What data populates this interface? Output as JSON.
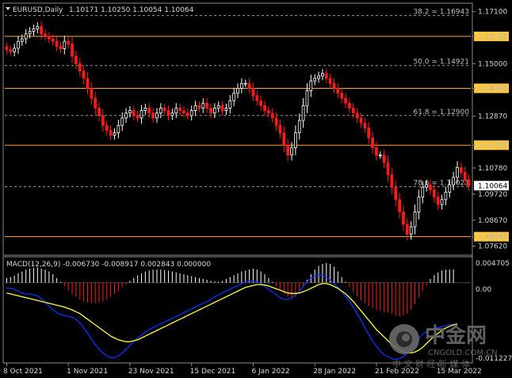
{
  "header": {
    "symbol": "EURUSD,Daily",
    "ohlc": "1.10171 1.10250 1.10054 1.10064"
  },
  "macd": {
    "label": "MACD(12,26,9) -0.006730 -0.008917 0.002843 0.000000",
    "ticks": [
      "0.004705",
      "0.00",
      "-0.011227"
    ]
  },
  "watermark": {
    "brand": "中金网",
    "domain": "CNGOLD.COM.CN",
    "tagline": "中 文 财 经 新 媒 体"
  },
  "colors": {
    "background": "#000000",
    "bull": "#ffffff",
    "bear": "#ff1a1a",
    "level_line": "#ffa733",
    "level_box": "#ffc83c",
    "grid": "#3a3a3a",
    "macd_line": "#0033ff",
    "signal_line": "#ffff33"
  },
  "chart_data": {
    "type": "candlestick",
    "symbol": "EURUSD",
    "timeframe": "Daily",
    "y_ticks": [
      "1.17100",
      "1.16100",
      "1.15000",
      "1.14000",
      "1.12870",
      "1.11700",
      "1.10780",
      "1.09720",
      "1.08670",
      "1.08000",
      "1.07620"
    ],
    "ylim": [
      1.0738,
      1.1738
    ],
    "x_ticks": [
      "8 Oct 2021",
      "1 Nov 2021",
      "23 Nov 2021",
      "15 Dec 2021",
      "6 Jan 2022",
      "28 Jan 2022",
      "21 Feb 2022",
      "15 Mar 2022"
    ],
    "x_tick_index": [
      0,
      16,
      32,
      48,
      64,
      80,
      96,
      112
    ],
    "levels": [
      {
        "label": "1.16100",
        "value": 1.161
      },
      {
        "label": "1.14000",
        "value": 1.14
      },
      {
        "label": "1.11700",
        "value": 1.117
      },
      {
        "label": "1.08000",
        "value": 1.08
      }
    ],
    "fibonacci": [
      {
        "label": "38.2 = 1.16943",
        "value": 1.16943
      },
      {
        "label": "50.0 = 1.14921",
        "value": 1.14921
      },
      {
        "label": "61.8 = 1.12900",
        "value": 1.129
      },
      {
        "label": "78.6 = 1.10021",
        "value": 1.10021
      }
    ],
    "current_price": {
      "label": "1.10064",
      "value": 1.10064
    },
    "close": [
      1.1556,
      1.1548,
      1.1562,
      1.159,
      1.16,
      1.162,
      1.163,
      1.164,
      1.165,
      1.162,
      1.161,
      1.16,
      1.159,
      1.157,
      1.156,
      1.159,
      1.158,
      1.153,
      1.15,
      1.147,
      1.144,
      1.14,
      1.136,
      1.132,
      1.129,
      1.125,
      1.123,
      1.121,
      1.122,
      1.125,
      1.128,
      1.13,
      1.131,
      1.129,
      1.128,
      1.131,
      1.132,
      1.13,
      1.128,
      1.13,
      1.132,
      1.131,
      1.129,
      1.13,
      1.132,
      1.131,
      1.13,
      1.129,
      1.131,
      1.133,
      1.132,
      1.134,
      1.132,
      1.13,
      1.132,
      1.133,
      1.131,
      1.132,
      1.135,
      1.138,
      1.14,
      1.142,
      1.142,
      1.14,
      1.137,
      1.135,
      1.133,
      1.131,
      1.13,
      1.128,
      1.125,
      1.122,
      1.117,
      1.113,
      1.116,
      1.122,
      1.127,
      1.133,
      1.139,
      1.143,
      1.144,
      1.145,
      1.146,
      1.144,
      1.142,
      1.14,
      1.138,
      1.136,
      1.134,
      1.132,
      1.13,
      1.128,
      1.126,
      1.124,
      1.12,
      1.116,
      1.113,
      1.113,
      1.11,
      1.105,
      1.1,
      1.095,
      1.09,
      1.085,
      1.081,
      1.084,
      1.09,
      1.096,
      1.1,
      1.101,
      1.099,
      1.096,
      1.093,
      1.095,
      1.098,
      1.101,
      1.104,
      1.108,
      1.106,
      1.103,
      1.1006
    ],
    "macd_histogram": [
      0.001,
      0.0012,
      0.0015,
      0.002,
      0.0024,
      0.0028,
      0.003,
      0.0032,
      0.0033,
      0.003,
      0.0028,
      0.0024,
      0.0018,
      0.001,
      0.0002,
      -0.0008,
      -0.0016,
      -0.0024,
      -0.003,
      -0.0036,
      -0.004,
      -0.0042,
      -0.0044,
      -0.0044,
      -0.0042,
      -0.004,
      -0.0036,
      -0.003,
      -0.0024,
      -0.0018,
      -0.001,
      -0.0004,
      0.0004,
      0.001,
      0.0016,
      0.002,
      0.0024,
      0.0026,
      0.0028,
      0.0028,
      0.0028,
      0.0027,
      0.0026,
      0.0024,
      0.0022,
      0.002,
      0.0018,
      0.0016,
      0.0014,
      0.0012,
      0.001,
      0.0008,
      0.0006,
      0.0004,
      0.0003,
      0.0002,
      0.0004,
      0.0008,
      0.0012,
      0.0016,
      0.002,
      0.0024,
      0.0026,
      0.0028,
      0.003,
      0.0028,
      0.0024,
      0.0018,
      0.001,
      0.0002,
      -0.0008,
      -0.0016,
      -0.0024,
      -0.003,
      -0.0034,
      -0.003,
      -0.002,
      -0.0008,
      0.0006,
      0.0018,
      0.0028,
      0.0036,
      0.004,
      0.0042,
      0.004,
      0.0034,
      0.0024,
      0.0012,
      0.0002,
      -0.001,
      -0.002,
      -0.003,
      -0.0038,
      -0.0044,
      -0.005,
      -0.0054,
      -0.0058,
      -0.006,
      -0.0062,
      -0.0064,
      -0.0066,
      -0.007,
      -0.0072,
      -0.007,
      -0.0066,
      -0.0058,
      -0.0046,
      -0.0032,
      -0.0018,
      -0.0006,
      0.0008,
      0.0016,
      0.0022,
      0.0026,
      0.0028,
      0.0028,
      0.0028
    ],
    "macd_line": [
      -0.0012,
      -0.0012,
      -0.0014,
      -0.0018,
      -0.0022,
      -0.0024,
      -0.0024,
      -0.0026,
      -0.0028,
      -0.0034,
      -0.0042,
      -0.005,
      -0.0058,
      -0.0064,
      -0.0068,
      -0.007,
      -0.0072,
      -0.0074,
      -0.0078,
      -0.0086,
      -0.0096,
      -0.0108,
      -0.012,
      -0.0132,
      -0.0142,
      -0.015,
      -0.0156,
      -0.016,
      -0.016,
      -0.0156,
      -0.015,
      -0.0142,
      -0.0134,
      -0.0126,
      -0.0118,
      -0.0112,
      -0.0106,
      -0.01,
      -0.0096,
      -0.0092,
      -0.0088,
      -0.0084,
      -0.008,
      -0.0076,
      -0.0072,
      -0.0068,
      -0.0064,
      -0.006,
      -0.0056,
      -0.0052,
      -0.0048,
      -0.0044,
      -0.004,
      -0.0036,
      -0.003,
      -0.0026,
      -0.0022,
      -0.0018,
      -0.0014,
      -0.001,
      -0.0006,
      -0.0002,
      0.0002,
      0.0004,
      0.0004,
      0.0002,
      -0.0002,
      -0.0008,
      -0.0014,
      -0.002,
      -0.0026,
      -0.0032,
      -0.0036,
      -0.0036,
      -0.0032,
      -0.0026,
      -0.0018,
      -0.0008,
      0.0002,
      0.001,
      0.0014,
      0.0016,
      0.0016,
      0.0012,
      0.0006,
      -0.0002,
      -0.001,
      -0.002,
      -0.003,
      -0.004,
      -0.0052,
      -0.0066,
      -0.008,
      -0.0096,
      -0.011,
      -0.0124,
      -0.0136,
      -0.0146,
      -0.0154,
      -0.0158,
      -0.0162,
      -0.0164,
      -0.0162,
      -0.0158,
      -0.015,
      -0.014,
      -0.0128,
      -0.0118,
      -0.011,
      -0.0104,
      -0.01,
      -0.0098,
      -0.0096,
      -0.0094,
      -0.0092,
      -0.009,
      -0.0089,
      -0.0089
    ],
    "signal_line": [
      -0.0022,
      -0.0024,
      -0.0026,
      -0.0028,
      -0.003,
      -0.0032,
      -0.0034,
      -0.0036,
      -0.0038,
      -0.004,
      -0.0042,
      -0.0044,
      -0.0046,
      -0.0048,
      -0.005,
      -0.0052,
      -0.0055,
      -0.0058,
      -0.0062,
      -0.0066,
      -0.0072,
      -0.0078,
      -0.0084,
      -0.009,
      -0.0096,
      -0.0102,
      -0.0108,
      -0.0114,
      -0.0118,
      -0.0122,
      -0.0124,
      -0.0126,
      -0.0126,
      -0.0124,
      -0.0122,
      -0.0118,
      -0.0114,
      -0.011,
      -0.0106,
      -0.0102,
      -0.0098,
      -0.0094,
      -0.009,
      -0.0086,
      -0.0082,
      -0.0078,
      -0.0074,
      -0.007,
      -0.0066,
      -0.0062,
      -0.0058,
      -0.0054,
      -0.005,
      -0.0046,
      -0.0042,
      -0.0038,
      -0.0034,
      -0.003,
      -0.0026,
      -0.0022,
      -0.0018,
      -0.0014,
      -0.001,
      -0.0008,
      -0.0006,
      -0.0004,
      -0.0004,
      -0.0005,
      -0.0007,
      -0.001,
      -0.0013,
      -0.0016,
      -0.0019,
      -0.0022,
      -0.0023,
      -0.0023,
      -0.0022,
      -0.0019,
      -0.0016,
      -0.0012,
      -0.0008,
      -0.0004,
      -0.0002,
      -0.0002,
      -0.0004,
      -0.0008,
      -0.0012,
      -0.0018,
      -0.0024,
      -0.0032,
      -0.004,
      -0.005,
      -0.006,
      -0.007,
      -0.008,
      -0.009,
      -0.01,
      -0.0108,
      -0.0116,
      -0.0124,
      -0.0132,
      -0.0138,
      -0.0144,
      -0.0148,
      -0.015,
      -0.015,
      -0.0148,
      -0.0144,
      -0.0138,
      -0.013,
      -0.0122,
      -0.0114,
      -0.0108,
      -0.0102,
      -0.0097,
      -0.0093,
      -0.009,
      -0.0088
    ]
  }
}
